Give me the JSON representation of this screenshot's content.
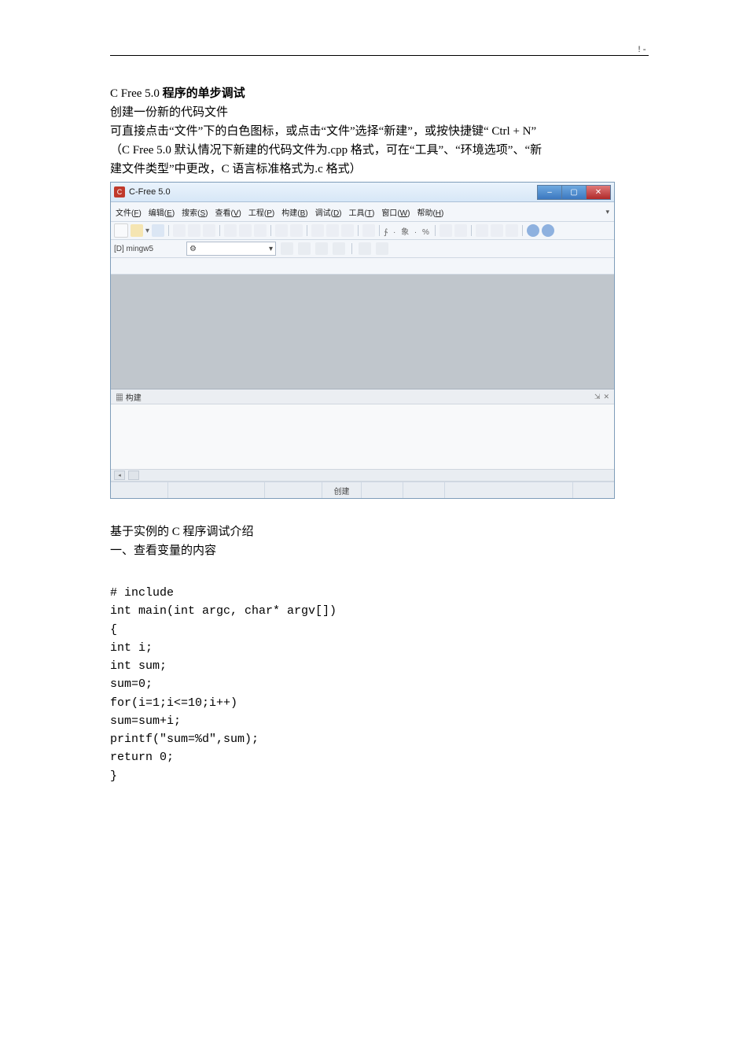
{
  "page_mark": "!-",
  "heading": {
    "prefix": "C Free 5.0 ",
    "bold": "程序的单步调试"
  },
  "intro_line2": "创建一份新的代码文件",
  "intro_line3": "可直接点击“文件”下的白色图标，或点击“文件”选择“新建”，或按快捷键“  Ctrl + N”",
  "intro_line4": "（C Free 5.0 默认情况下新建的代码文件为.cpp 格式，可在“工具”、“环境选项”、“新",
  "intro_line5": "建文件类型”中更改，C 语言标准格式为.c 格式）",
  "app": {
    "title": "C-Free 5.0",
    "menu": {
      "file": {
        "label": "文件",
        "accel": "F"
      },
      "edit": {
        "label": "编辑",
        "accel": "E"
      },
      "search": {
        "label": "搜索",
        "accel": "S"
      },
      "view": {
        "label": "查看",
        "accel": "V"
      },
      "project": {
        "label": "工程",
        "accel": "P"
      },
      "build": {
        "label": "构建",
        "accel": "B"
      },
      "debug": {
        "label": "调试",
        "accel": "D"
      },
      "tools": {
        "label": "工具",
        "accel": "T"
      },
      "window": {
        "label": "窗口",
        "accel": "W"
      },
      "help": {
        "label": "帮助",
        "accel": "H"
      }
    },
    "compiler_label": "[D] mingw5",
    "build_panel": {
      "icon_label": "构建"
    },
    "status": {
      "center": "创建"
    }
  },
  "section2_title": "基于实例的 C 程序调试介绍",
  "section2_sub": "一、查看变量的内容",
  "code_lines": [
    "# include",
    "int main(int argc, char* argv[])",
    "{",
    "int i;",
    "int sum;",
    "sum=0;",
    "for(i=1;i<=10;i++)",
    "sum=sum+i;",
    "printf(\"sum=%d\",sum);",
    "return 0;",
    "}"
  ]
}
